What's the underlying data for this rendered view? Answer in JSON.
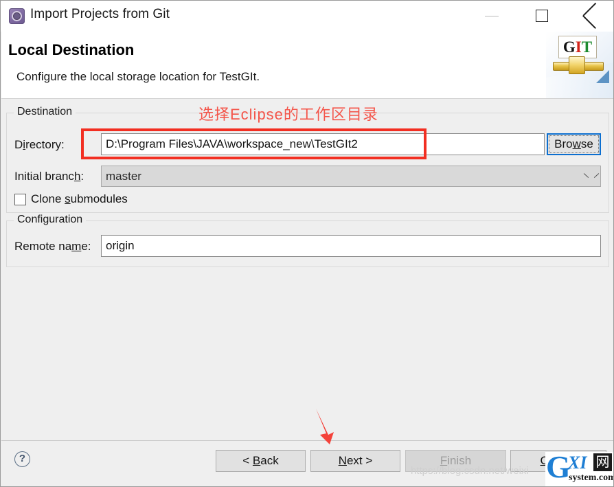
{
  "window": {
    "title": "Import Projects from Git",
    "icon": "git-import-icon",
    "controls": {
      "minimize": "minimize-icon",
      "maximize": "maximize-icon",
      "close": "close-icon"
    }
  },
  "header": {
    "page_title": "Local Destination",
    "page_description": "Configure the local storage location for TestGIt.",
    "banner": {
      "logo_g": "G",
      "logo_i": "I",
      "logo_t": "T"
    }
  },
  "destination": {
    "group_title": "Destination",
    "directory": {
      "label_pre": "D",
      "label_mnemonic": "i",
      "label_post": "rectory:",
      "value": "D:\\Program Files\\JAVA\\workspace_new\\TestGIt2"
    },
    "browse_button": {
      "label_pre": "Bro",
      "label_mnemonic": "w",
      "label_post": "se"
    },
    "initial_branch": {
      "label_pre": "Initial branc",
      "label_mnemonic": "h",
      "label_post": ":",
      "value": "master"
    },
    "clone_submodules": {
      "label_pre": "Clone ",
      "label_mnemonic": "s",
      "label_post": "ubmodules",
      "checked": false
    }
  },
  "configuration": {
    "group_title": "Configuration",
    "remote_name": {
      "label_pre": "Remote na",
      "label_mnemonic": "m",
      "label_post": "e:",
      "value": "origin"
    }
  },
  "footer": {
    "help_icon": "?",
    "buttons": {
      "back": {
        "pre": "< ",
        "mnemonic": "B",
        "post": "ack"
      },
      "next": {
        "pre": "",
        "mnemonic": "N",
        "post": "ext >"
      },
      "finish": {
        "pre": "",
        "mnemonic": "F",
        "post": "inish"
      },
      "cancel": {
        "pre": "",
        "mnemonic": "C",
        "post": "ancel"
      }
    }
  },
  "annotations": {
    "note_text": "选择Eclipse的工作区目录",
    "note_color": "#f4554a",
    "highlight_color": "#f22f22",
    "arrow_color": "#f4423a"
  },
  "watermarks": {
    "url": "https://blog.csdn.net/weixi",
    "logo_g": "G",
    "logo_xi": "XI",
    "logo_cn": "网",
    "logo_sub": "system.com"
  }
}
